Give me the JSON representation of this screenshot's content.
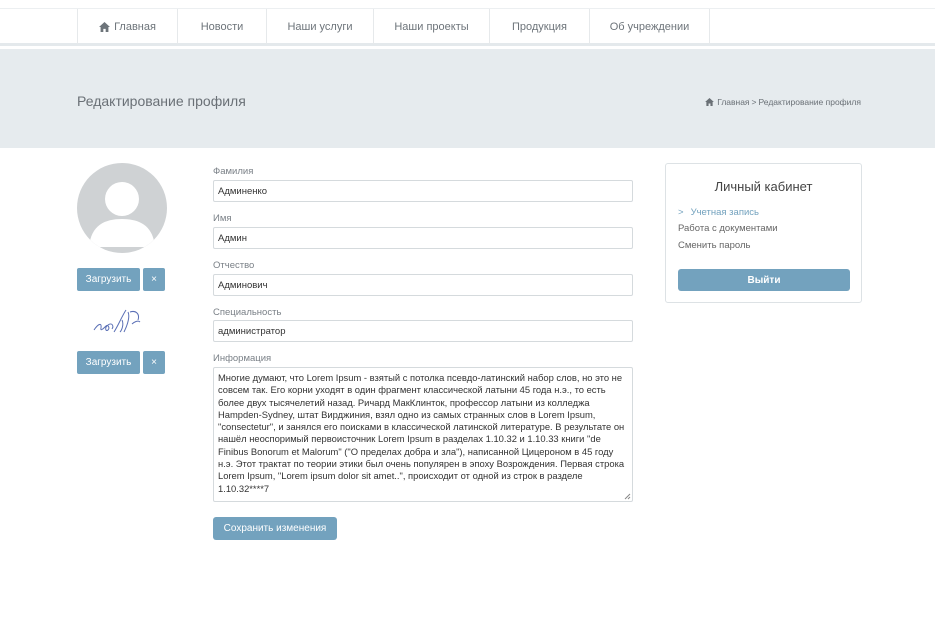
{
  "nav": {
    "items": [
      {
        "label": "Главная",
        "icon": "home-icon"
      },
      {
        "label": "Новости"
      },
      {
        "label": "Наши услуги"
      },
      {
        "label": "Наши проекты"
      },
      {
        "label": "Продукция"
      },
      {
        "label": "Об учреждении"
      }
    ]
  },
  "banner": {
    "title": "Редактирование профиля",
    "breadcrumb": {
      "home": "Главная",
      "separator": ">",
      "current": "Редактирование профиля"
    }
  },
  "left": {
    "avatar_upload": "Загрузить",
    "avatar_remove": "×",
    "signature_upload": "Загрузить",
    "signature_remove": "×"
  },
  "form": {
    "lastname": {
      "label": "Фамилия",
      "value": "Админенко"
    },
    "firstname": {
      "label": "Имя",
      "value": "Админ"
    },
    "patronymic": {
      "label": "Отчество",
      "value": "Админович"
    },
    "specialty": {
      "label": "Специальность",
      "value": "администратор"
    },
    "info": {
      "label": "Информация",
      "value": "Многие думают, что Lorem Ipsum - взятый с потолка псевдо-латинский набор слов, но это не совсем так. Его корни уходят в один фрагмент классической латыни 45 года н.э., то есть более двух тысячелетий назад. Ричард МакКлинток, профессор латыни из колледжа Hampden-Sydney, штат Вирджиния, взял одно из самых странных слов в Lorem Ipsum, \"consectetur\", и занялся его поисками в классической латинской литературе. В результате он нашёл неоспоримый первоисточник Lorem Ipsum в разделах 1.10.32 и 1.10.33 книги \"de Finibus Bonorum et Malorum\" (\"О пределах добра и зла\"), написанной Цицероном в 45 году н.э. Этот трактат по теории этики был очень популярен в эпоху Возрождения. Первая строка Lorem Ipsum, \"Lorem ipsum dolor sit amet..\", происходит от одной из строк в разделе 1.10.32****7"
    },
    "save_label": "Сохранить изменения"
  },
  "cabinet": {
    "title": "Личный кабинет",
    "links": [
      {
        "label": "Учетная запись",
        "active": true
      },
      {
        "label": "Работа с документами",
        "active": false
      },
      {
        "label": "Сменить пароль",
        "active": false
      }
    ],
    "logout_label": "Выйти"
  },
  "colors": {
    "accent": "#73a2be",
    "banner": "#e6ebee",
    "avatar": "#cfd2d4"
  }
}
